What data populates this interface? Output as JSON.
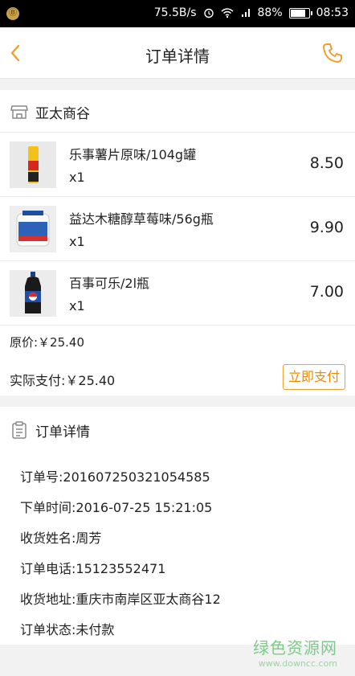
{
  "status_bar": {
    "app_badge": "Ⓑ",
    "speed": "75.5B/s",
    "battery": "88%",
    "time": "08:53",
    "battery_level": 0.88
  },
  "header": {
    "title": "订单详情",
    "back_icon": "chevron-left-icon",
    "phone_icon": "phone-icon",
    "accent_color": "#f0a030"
  },
  "shop": {
    "name": "亚太商谷",
    "icon": "store-icon",
    "items": [
      {
        "name": "乐事薯片原味/104g罐",
        "qty": "x1",
        "price": "8.50"
      },
      {
        "name": "益达木糖醇草莓味/56g瓶",
        "qty": "x1",
        "price": "9.90"
      },
      {
        "name": "百事可乐/2l瓶",
        "qty": "x1",
        "price": "7.00"
      }
    ],
    "original_price": "原价:￥25.40",
    "actual_paid": "实际支付:￥25.40",
    "pay_button": "立即支付"
  },
  "detail": {
    "title": "订单详情",
    "icon": "clipboard-icon",
    "rows": [
      "订单号:201607250321054585",
      "下单时间:2016-07-25 15:21:05",
      "收货姓名:周芳",
      "订单电话:15123552471",
      "收货地址:重庆市南岸区亚太商谷12",
      "订单状态:未付款"
    ]
  },
  "watermark": {
    "cn": "绿色资源网",
    "url": "www.downcc.com"
  }
}
